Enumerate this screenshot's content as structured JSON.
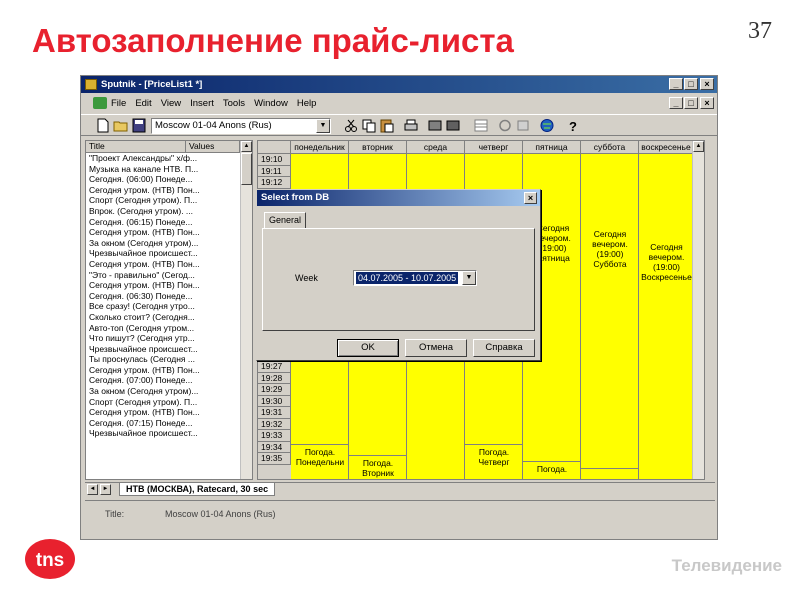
{
  "slide": {
    "title": "Автозаполнение прайс-листа",
    "number": "37",
    "footer": "Телевидение",
    "logo_text": "tns",
    "logo_color": "#e8212e"
  },
  "window": {
    "title": "Sputnik - [PriceList1 *]",
    "menu": [
      "File",
      "Edit",
      "View",
      "Insert",
      "Tools",
      "Window",
      "Help"
    ],
    "channel": "Moscow 01-04 Anons (Rus)"
  },
  "left_panel": {
    "columns": [
      "Title",
      "Values"
    ],
    "rows": [
      "\"Проект Александры\" х/ф...",
      "Музыка на канале НТВ. П...",
      "Сегодня. (06:00) Понеде...",
      "Сегодня утром. (НТВ) Пон...",
      "Спорт (Сегодня утром). П...",
      "Впрок. (Сегодня утром). ...",
      "Сегодня. (06:15) Понеде...",
      "Сегодня утром. (НТВ) Пон...",
      "За окном (Сегодня утром)...",
      "Чрезвычайное происшест...",
      "Сегодня утром. (НТВ) Пон...",
      "\"Это - правильно\" (Сегод...",
      "Сегодня утром. (НТВ) Пон...",
      "Сегодня. (06:30) Понеде...",
      "Все сразу! (Сегодня утро...",
      "Сколько стоит? (Сегодня...",
      "Авто-топ (Сегодня утром...",
      "Что пишут? (Сегодня утр...",
      "Чрезвычайное происшест...",
      "Ты проснулась (Сегодня ...",
      "Сегодня утром. (НТВ) Пон...",
      "Сегодня. (07:00) Понеде...",
      "За окном (Сегодня утром)...",
      "Спорт (Сегодня утром). П...",
      "Сегодня утром. (НТВ) Пон...",
      "Сегодня. (07:15) Понеде...",
      "Чрезвычайное происшест..."
    ]
  },
  "grid": {
    "times_top": [
      "19:10",
      "19:11",
      "19:12"
    ],
    "times_bottom": [
      "19:27",
      "19:28",
      "19:29",
      "19:30",
      "19:31",
      "19:32",
      "19:33",
      "19:34",
      "19:35"
    ],
    "days": [
      "понедельник",
      "вторник",
      "среда",
      "четверг",
      "пятница",
      "суббота",
      "воскресенье"
    ],
    "cells": {
      "fri": "Сегодня\nвечером.\n(19:00)\nПятница",
      "sat": "Сегодня\nвечером.\n(19:00)\nСуббота",
      "sun": "Сегодня\nвечером.\n(19:00)\nВоскресенье",
      "mon_bottom": "Погода.\nПонедельни",
      "tue_bottom": "Погода.\nВторник",
      "thu_bottom": "Погода.\nЧетверг",
      "fri_bottom": "Погода."
    },
    "highlight_color": "#ffff00"
  },
  "bottom": {
    "tab": "НТВ (МОСКВА), Ratecard, 30 sec",
    "info_label": "Title:",
    "info_value": "Moscow 01-04 Anons (Rus)"
  },
  "dialog": {
    "title": "Select from DB",
    "tab": "General",
    "week_label": "Week",
    "week_value": "04.07.2005 - 10.07.2005",
    "ok": "OK",
    "cancel": "Отмена",
    "help": "Справка"
  }
}
